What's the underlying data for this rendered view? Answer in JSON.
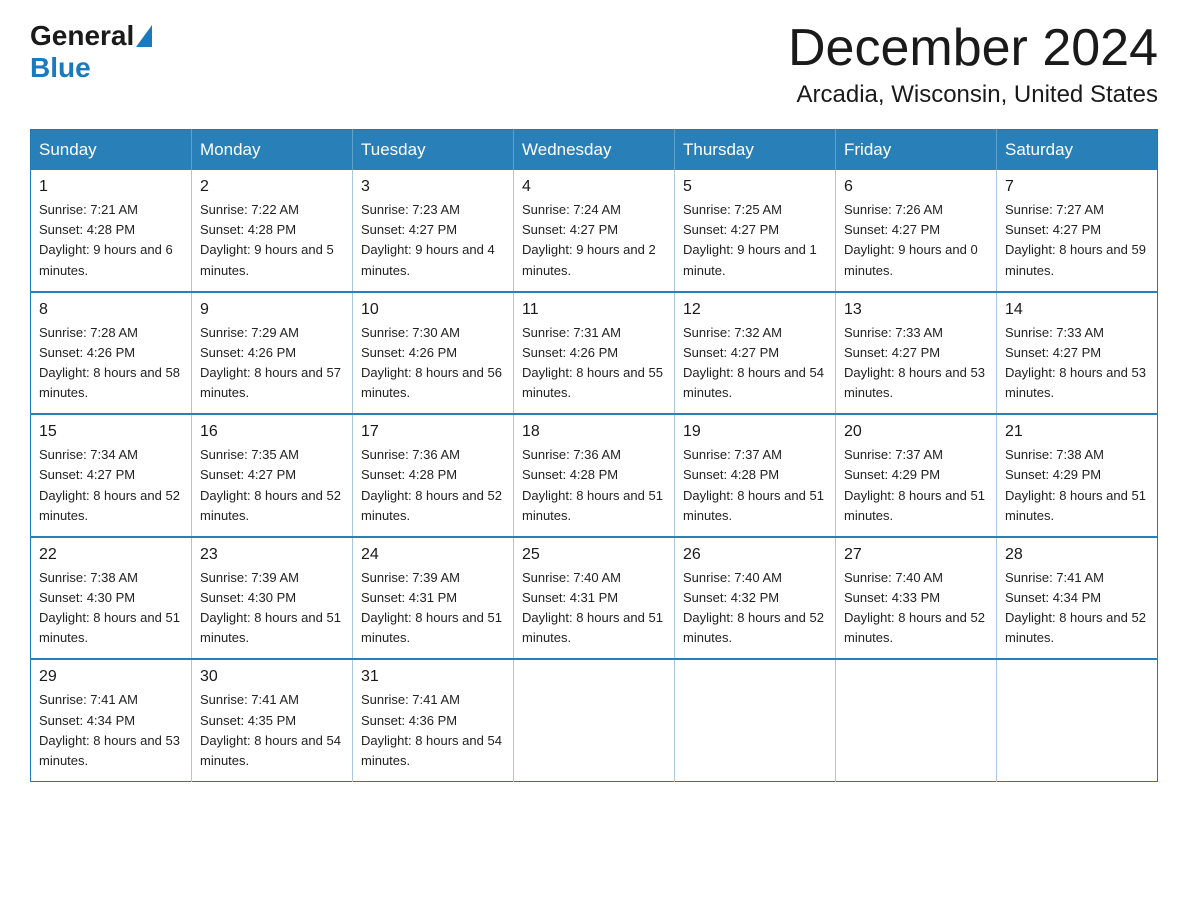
{
  "header": {
    "logo_general": "General",
    "logo_blue": "Blue",
    "title": "December 2024",
    "subtitle": "Arcadia, Wisconsin, United States"
  },
  "days_of_week": [
    "Sunday",
    "Monday",
    "Tuesday",
    "Wednesday",
    "Thursday",
    "Friday",
    "Saturday"
  ],
  "weeks": [
    [
      {
        "day": "1",
        "sunrise": "7:21 AM",
        "sunset": "4:28 PM",
        "daylight": "9 hours and 6 minutes."
      },
      {
        "day": "2",
        "sunrise": "7:22 AM",
        "sunset": "4:28 PM",
        "daylight": "9 hours and 5 minutes."
      },
      {
        "day": "3",
        "sunrise": "7:23 AM",
        "sunset": "4:27 PM",
        "daylight": "9 hours and 4 minutes."
      },
      {
        "day": "4",
        "sunrise": "7:24 AM",
        "sunset": "4:27 PM",
        "daylight": "9 hours and 2 minutes."
      },
      {
        "day": "5",
        "sunrise": "7:25 AM",
        "sunset": "4:27 PM",
        "daylight": "9 hours and 1 minute."
      },
      {
        "day": "6",
        "sunrise": "7:26 AM",
        "sunset": "4:27 PM",
        "daylight": "9 hours and 0 minutes."
      },
      {
        "day": "7",
        "sunrise": "7:27 AM",
        "sunset": "4:27 PM",
        "daylight": "8 hours and 59 minutes."
      }
    ],
    [
      {
        "day": "8",
        "sunrise": "7:28 AM",
        "sunset": "4:26 PM",
        "daylight": "8 hours and 58 minutes."
      },
      {
        "day": "9",
        "sunrise": "7:29 AM",
        "sunset": "4:26 PM",
        "daylight": "8 hours and 57 minutes."
      },
      {
        "day": "10",
        "sunrise": "7:30 AM",
        "sunset": "4:26 PM",
        "daylight": "8 hours and 56 minutes."
      },
      {
        "day": "11",
        "sunrise": "7:31 AM",
        "sunset": "4:26 PM",
        "daylight": "8 hours and 55 minutes."
      },
      {
        "day": "12",
        "sunrise": "7:32 AM",
        "sunset": "4:27 PM",
        "daylight": "8 hours and 54 minutes."
      },
      {
        "day": "13",
        "sunrise": "7:33 AM",
        "sunset": "4:27 PM",
        "daylight": "8 hours and 53 minutes."
      },
      {
        "day": "14",
        "sunrise": "7:33 AM",
        "sunset": "4:27 PM",
        "daylight": "8 hours and 53 minutes."
      }
    ],
    [
      {
        "day": "15",
        "sunrise": "7:34 AM",
        "sunset": "4:27 PM",
        "daylight": "8 hours and 52 minutes."
      },
      {
        "day": "16",
        "sunrise": "7:35 AM",
        "sunset": "4:27 PM",
        "daylight": "8 hours and 52 minutes."
      },
      {
        "day": "17",
        "sunrise": "7:36 AM",
        "sunset": "4:28 PM",
        "daylight": "8 hours and 52 minutes."
      },
      {
        "day": "18",
        "sunrise": "7:36 AM",
        "sunset": "4:28 PM",
        "daylight": "8 hours and 51 minutes."
      },
      {
        "day": "19",
        "sunrise": "7:37 AM",
        "sunset": "4:28 PM",
        "daylight": "8 hours and 51 minutes."
      },
      {
        "day": "20",
        "sunrise": "7:37 AM",
        "sunset": "4:29 PM",
        "daylight": "8 hours and 51 minutes."
      },
      {
        "day": "21",
        "sunrise": "7:38 AM",
        "sunset": "4:29 PM",
        "daylight": "8 hours and 51 minutes."
      }
    ],
    [
      {
        "day": "22",
        "sunrise": "7:38 AM",
        "sunset": "4:30 PM",
        "daylight": "8 hours and 51 minutes."
      },
      {
        "day": "23",
        "sunrise": "7:39 AM",
        "sunset": "4:30 PM",
        "daylight": "8 hours and 51 minutes."
      },
      {
        "day": "24",
        "sunrise": "7:39 AM",
        "sunset": "4:31 PM",
        "daylight": "8 hours and 51 minutes."
      },
      {
        "day": "25",
        "sunrise": "7:40 AM",
        "sunset": "4:31 PM",
        "daylight": "8 hours and 51 minutes."
      },
      {
        "day": "26",
        "sunrise": "7:40 AM",
        "sunset": "4:32 PM",
        "daylight": "8 hours and 52 minutes."
      },
      {
        "day": "27",
        "sunrise": "7:40 AM",
        "sunset": "4:33 PM",
        "daylight": "8 hours and 52 minutes."
      },
      {
        "day": "28",
        "sunrise": "7:41 AM",
        "sunset": "4:34 PM",
        "daylight": "8 hours and 52 minutes."
      }
    ],
    [
      {
        "day": "29",
        "sunrise": "7:41 AM",
        "sunset": "4:34 PM",
        "daylight": "8 hours and 53 minutes."
      },
      {
        "day": "30",
        "sunrise": "7:41 AM",
        "sunset": "4:35 PM",
        "daylight": "8 hours and 54 minutes."
      },
      {
        "day": "31",
        "sunrise": "7:41 AM",
        "sunset": "4:36 PM",
        "daylight": "8 hours and 54 minutes."
      },
      null,
      null,
      null,
      null
    ]
  ],
  "labels": {
    "sunrise": "Sunrise:",
    "sunset": "Sunset:",
    "daylight": "Daylight:"
  }
}
